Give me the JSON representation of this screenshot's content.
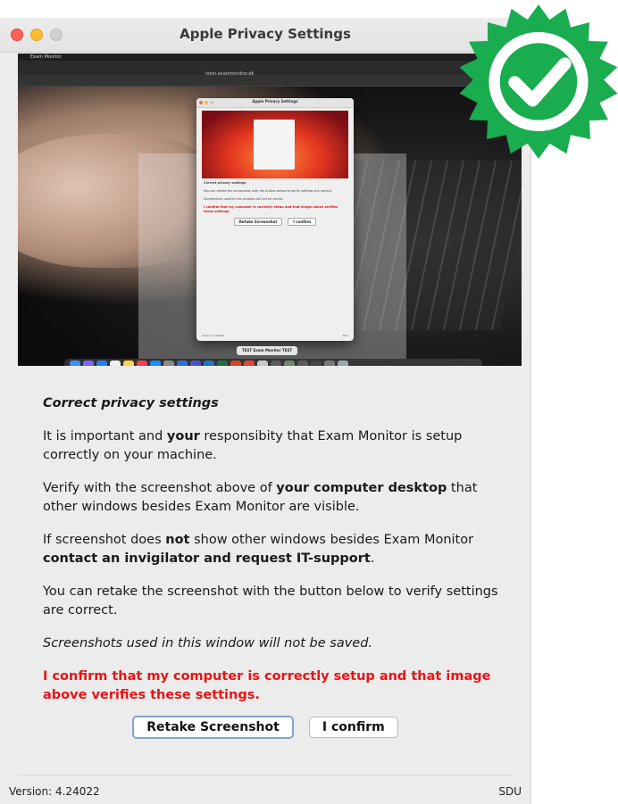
{
  "window": {
    "title": "Apple Privacy Settings"
  },
  "preview": {
    "menubar_app": "Exam Monitor",
    "url": "login.exammonitor.dk",
    "mini_window": {
      "title": "Apple Privacy Settings",
      "heading": "Correct privacy settings",
      "retake_label": "Retake Screenshot",
      "confirm_label": "I confirm",
      "version": "Version: 4.24022",
      "org": "SDU"
    },
    "dock_pill": "TEST Exam Monitor TEST"
  },
  "content": {
    "heading": "Correct privacy settings",
    "p1_a": "It is important and ",
    "p1_b": "your",
    "p1_c": " responsibity that Exam Monitor is setup correctly on your machine.",
    "p2_a": "Verify with the screenshot above of ",
    "p2_b": "your computer desktop",
    "p2_c": " that other windows besides Exam Monitor are visible.",
    "p3_a": "If screenshot does ",
    "p3_b": "not",
    "p3_c": " show other windows besides Exam Monitor ",
    "p3_d": "contact an invigilator and request IT-support",
    "p3_e": ".",
    "p4": "You can retake the screenshot with the button below to verify settings are correct.",
    "p5": "Screenshots used in this window will not be saved.",
    "confirm_statement": "I confirm that my computer is correctly setup and that image above verifies these settings."
  },
  "buttons": {
    "retake": "Retake Screenshot",
    "confirm": "I confirm"
  },
  "footer": {
    "version": "Version: 4.24022",
    "org": "SDU"
  },
  "badge": {
    "icon": "verified-checkmark-icon",
    "color": "#19ad4f"
  }
}
